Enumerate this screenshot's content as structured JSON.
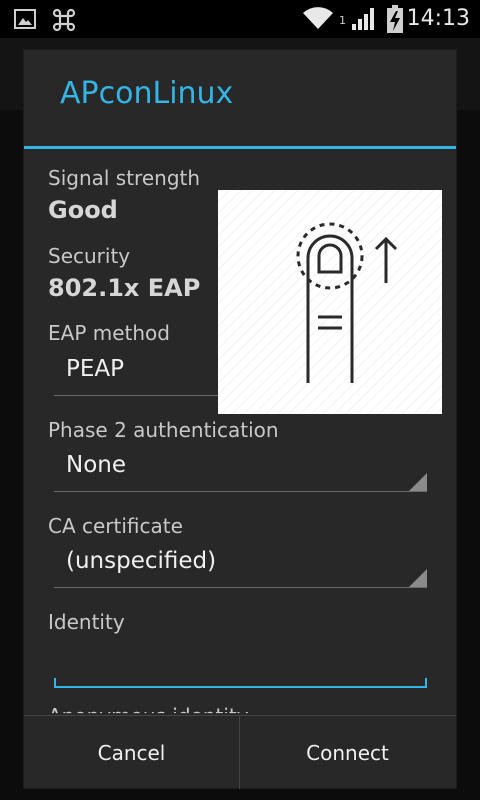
{
  "status_bar": {
    "time": "14:13",
    "signal_sub_label": "1",
    "icons": [
      "picture-icon",
      "command-icon",
      "wifi-icon",
      "cell-signal-icon",
      "battery-charging-icon"
    ]
  },
  "dialog": {
    "title": "APconLinux",
    "signal_strength": {
      "label": "Signal strength",
      "value": "Good"
    },
    "security": {
      "label": "Security",
      "value": "802.1x EAP"
    },
    "eap_method": {
      "label": "EAP method",
      "value": "PEAP"
    },
    "phase2": {
      "label": "Phase 2 authentication",
      "value": "None"
    },
    "ca_certificate": {
      "label": "CA certificate",
      "value": "(unspecified)"
    },
    "identity": {
      "label": "Identity",
      "value": "",
      "placeholder": ""
    },
    "anonymous_identity": {
      "label": "Anonymous identity"
    },
    "buttons": {
      "cancel": "Cancel",
      "connect": "Connect"
    }
  },
  "overlay": {
    "icon": "swipe-up-gesture-icon"
  },
  "colors": {
    "accent": "#33b5e5",
    "dialog_bg": "#282828",
    "status_bar_bg": "#000000"
  }
}
